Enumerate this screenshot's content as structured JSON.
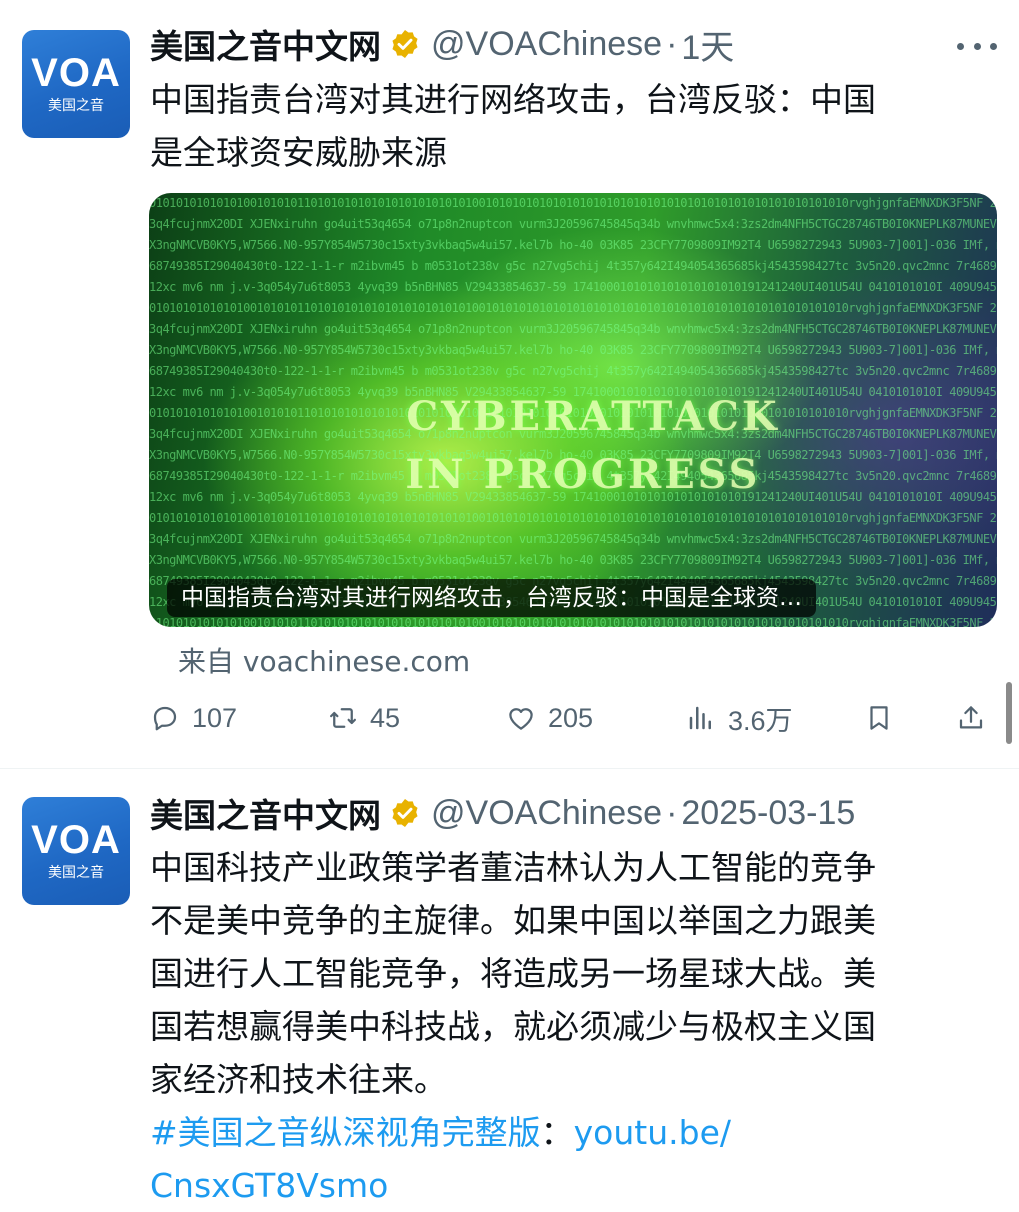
{
  "tweets": [
    {
      "avatar": {
        "logo": "VOA",
        "sub": "美国之音"
      },
      "name": "美国之音中文网",
      "handle": "@VOAChinese",
      "separator": "·",
      "time": "1天",
      "text_lines": [
        "中国指责台湾对其进行网络攻击，台湾反驳：中国",
        "是全球资安威胁来源"
      ],
      "card": {
        "image_text_1": "CYBERATTACK",
        "image_text_2": "IN PROGRESS",
        "caption": "中国指责台湾对其进行网络攻击，台湾反驳：中国是全球资…",
        "source": "来自 voachinese.com"
      },
      "actions": {
        "reply_count": "107",
        "retweet_count": "45",
        "like_count": "205",
        "views_count": "3.6万"
      }
    },
    {
      "avatar": {
        "logo": "VOA",
        "sub": "美国之音"
      },
      "name": "美国之音中文网",
      "handle": "@VOAChinese",
      "separator": "·",
      "time": "2025-03-15",
      "text_lines": [
        "中国科技产业政策学者董洁林认为人工智能的竞争",
        "不是美中竞争的主旋律。如果中国以举国之力跟美",
        "国进行人工智能竞争，将造成另一场星球大战。美",
        "国若想赢得美中科技战，就必须减少与极权主义国",
        "家经济和技术往来。"
      ],
      "hashtag": "#美国之音纵深视角完整版",
      "colon": "：",
      "link_part1": "youtu.be/",
      "link_part2": "CnsxGT8Vsmo"
    }
  ],
  "icons": [
    "verified-badge-icon",
    "more-icon",
    "reply-icon",
    "retweet-icon",
    "like-icon",
    "views-icon",
    "bookmark-icon",
    "share-icon"
  ],
  "colors": {
    "text": "#0f1419",
    "secondary": "#536471",
    "link": "#1d9bf0",
    "verified": "#e8b200",
    "avatar_bg": "#1f68c4"
  }
}
